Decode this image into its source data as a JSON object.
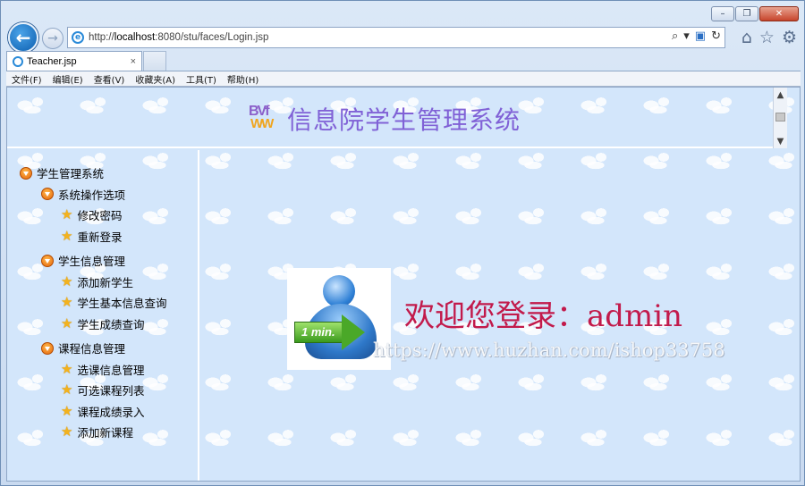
{
  "browser": {
    "address": {
      "url_prefix": "http://",
      "url_host": "localhost",
      "url_rest": ":8080/stu/faces/Login.jsp"
    },
    "tab": {
      "label": "Teacher.jsp",
      "close": "×"
    },
    "menu": [
      "文件(F)",
      "编辑(E)",
      "查看(V)",
      "收藏夹(A)",
      "工具(T)",
      "帮助(H)"
    ],
    "icons": [
      "back-icon",
      "forward-icon",
      "search-icon",
      "refresh-icon",
      "home-icon",
      "favorites-star-icon",
      "gear-icon"
    ]
  },
  "header": {
    "logo_top": "BVf",
    "logo_bottom": "WW",
    "title": "信息院学生管理系统"
  },
  "tree": {
    "root": "学生管理系统",
    "groups": [
      {
        "label": "系统操作选项",
        "items": [
          "修改密码",
          "重新登录"
        ]
      },
      {
        "label": "学生信息管理",
        "items": [
          "添加新学生",
          "学生基本信息查询",
          "学生成绩查询"
        ]
      },
      {
        "label": "课程信息管理",
        "items": [
          "选课信息管理",
          "可选课程列表",
          "课程成绩录入",
          "添加新课程"
        ]
      }
    ]
  },
  "main": {
    "image_label": "1 min.",
    "welcome": "欢迎您登录：admin",
    "watermark": "https://www.huzhan.com/ishop33758"
  },
  "colors": {
    "title": "#8061d6",
    "welcome": "#c21a4b",
    "page_bg": "#d3e6fb"
  }
}
